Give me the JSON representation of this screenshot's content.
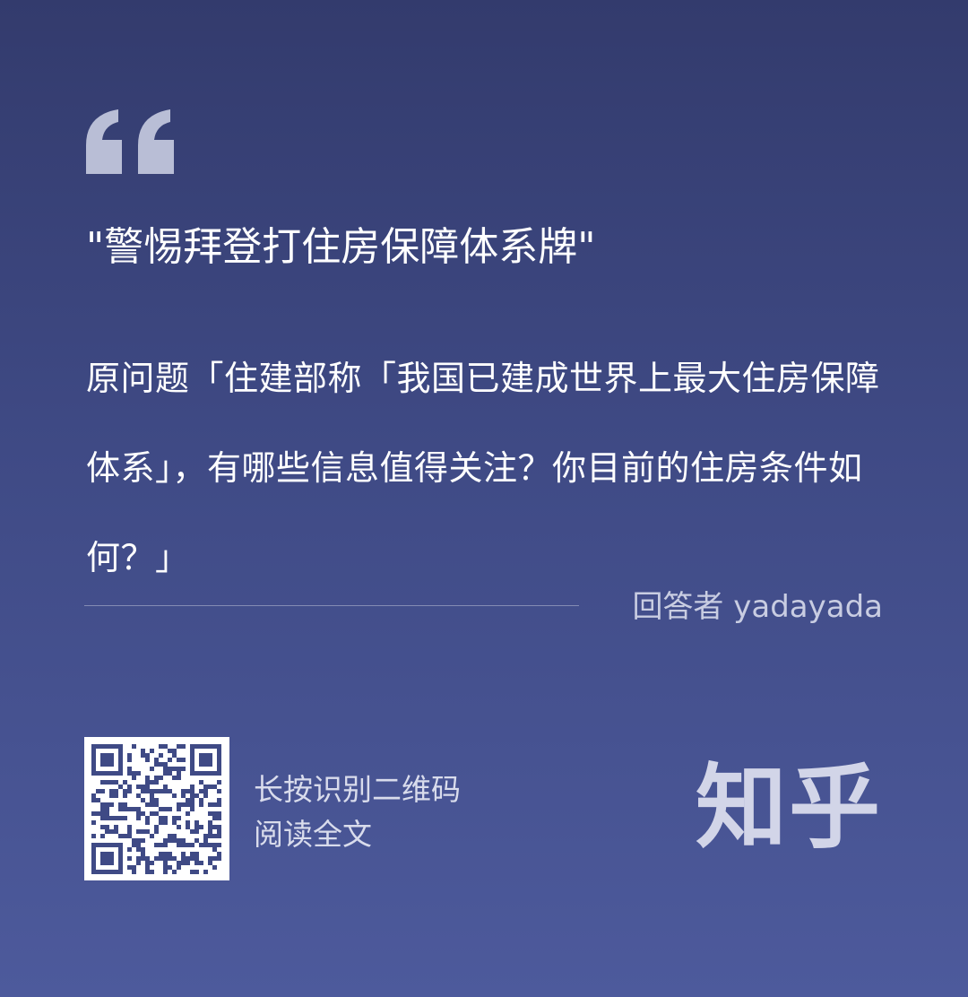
{
  "headline": "\"警惕拜登打住房保障体系牌\"",
  "question": "原问题「住建部称「我国已建成世界上最大住房保障体系」，有哪些信息值得关注？你目前的住房条件如何？」",
  "answerer": "回答者 yadayada",
  "qr_prompt": {
    "line1": "长按识别二维码",
    "line2": "阅读全文"
  },
  "logo": "知乎",
  "icons": {
    "quote": "quote-icon",
    "qr": "qr-code-icon"
  },
  "colors": {
    "background_top": "#333b6d",
    "background_bottom": "#4d5a9c",
    "quote_mark": "#b9bed6",
    "logo": "#d2d5e8"
  }
}
